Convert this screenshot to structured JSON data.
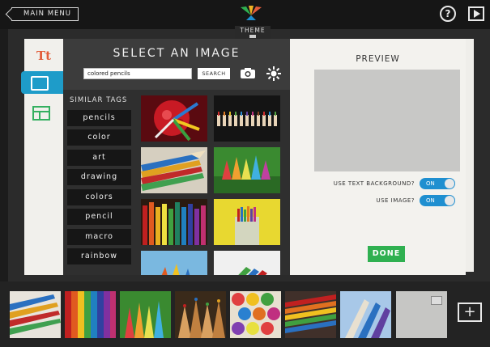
{
  "topbar": {
    "main_menu_label": "MAIN MENU",
    "help_label": "?",
    "theme_label": "THEME"
  },
  "tools": {
    "text_tool_label": "Tt",
    "icons": [
      "text-tool-icon",
      "image-tool-icon",
      "layout-tool-icon"
    ]
  },
  "select_panel": {
    "title": "SELECT AN IMAGE",
    "search_value": "colored pencils",
    "search_button_label": "SEARCH",
    "similar_tags_label": "SIMILAR TAGS",
    "tags": [
      "pencils",
      "color",
      "art",
      "drawing",
      "colors",
      "pencil",
      "macro",
      "rainbow"
    ]
  },
  "preview": {
    "title": "PREVIEW",
    "use_text_background_label": "USE TEXT BACKGROUND?",
    "use_text_background_value": "ON",
    "use_image_label": "USE IMAGE?",
    "use_image_value": "ON",
    "done_label": "DONE"
  },
  "filmstrip": {
    "add_label": "+"
  },
  "colors": {
    "accent_blue": "#1f8fd0",
    "done_green": "#2fb050",
    "text_tool_red": "#e25d3a",
    "layout_green": "#34b060"
  }
}
